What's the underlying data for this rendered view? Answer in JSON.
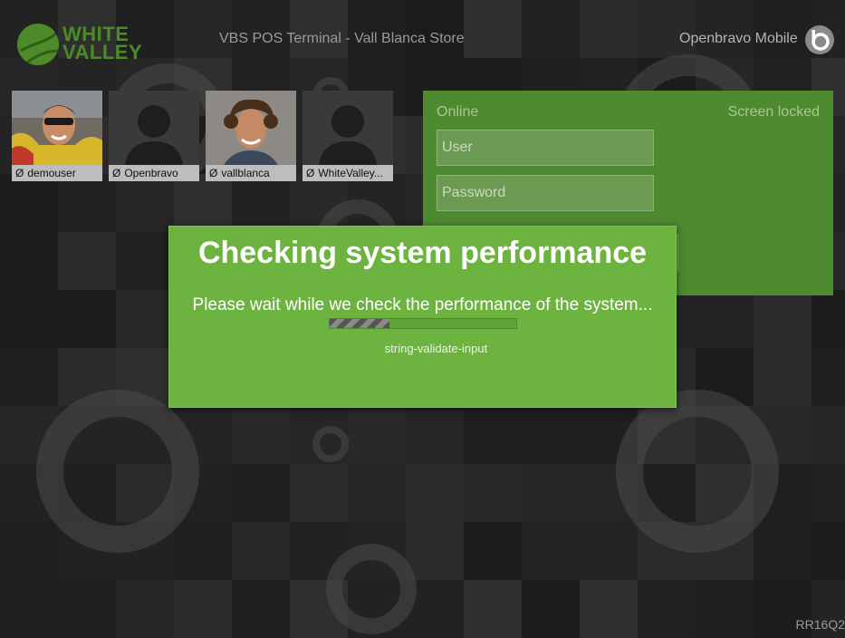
{
  "header": {
    "brand_line1": "WHITE",
    "brand_line2": "VALLEY",
    "terminal_title": "VBS POS Terminal - Vall Blanca Store",
    "app_name": "Openbravo Mobile"
  },
  "users": [
    {
      "name": "demouser",
      "status_icon": "Ø",
      "has_photo": true
    },
    {
      "name": "Openbravo",
      "status_icon": "Ø",
      "has_photo": false
    },
    {
      "name": "vallblanca",
      "status_icon": "Ø",
      "has_photo": true
    },
    {
      "name": "WhiteValley...",
      "status_icon": "Ø",
      "has_photo": false
    }
  ],
  "login": {
    "connection_status": "Online",
    "lock_status": "Screen locked",
    "user_placeholder": "User",
    "password_placeholder": "Password"
  },
  "modal": {
    "title": "Checking system performance",
    "message": "Please wait while we check the performance of the system...",
    "step": "string-validate-input",
    "progress_fraction": 0.32
  },
  "footer": {
    "version": "RR16Q2"
  },
  "colors": {
    "accent_green": "#6db33f",
    "panel_green": "#4e8a30",
    "brand_green": "#4d8a2a"
  }
}
